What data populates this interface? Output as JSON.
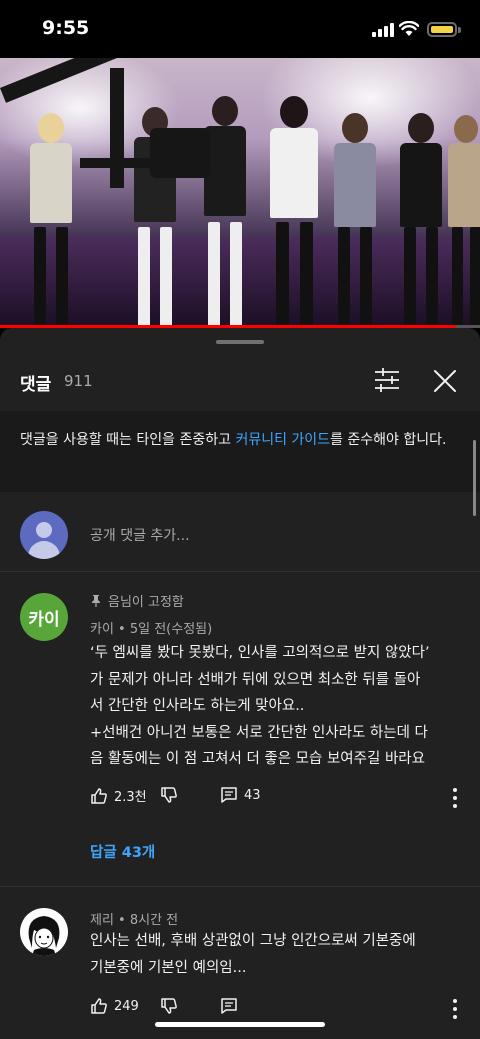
{
  "status_bar": {
    "time": "9:55"
  },
  "video": {
    "progress_fraction": 0.95
  },
  "comments_panel": {
    "title": "댓글",
    "count": "911",
    "guideline": {
      "prefix": "댓글을 사용할 때는 타인을 존중하고 ",
      "link": "커뮤니티 가이드",
      "suffix": "를 준수해야 합니다."
    },
    "add_comment_placeholder": "공개 댓글 추가...",
    "comments": [
      {
        "avatar_text": "카이",
        "pinned_label": "음님이 고정함",
        "author": "카이",
        "time": "5일 전(수정됨)",
        "lines": [
          "‘두 엠씨를 봤다 못봤다, 인사를 고의적으로 받지 않았다’",
          "가 문제가 아니라 선배가 뒤에 있으면 최소한 뒤를 돌아",
          "서 간단한 인사라도 하는게 맞아요..",
          "+선배건 아니건 보통은 서로 간단한 인사라도 하는데 다",
          "음 활동에는 이 점 고쳐서 더 좋은 모습 보여주길 바라요"
        ],
        "likes": "2.3천",
        "reply_count": "43",
        "replies_label": "답글 43개"
      },
      {
        "author": "제리",
        "time": "8시간 전",
        "lines": [
          "인사는 선배, 후배 상관없이 그냥 인간으로써 기본중에",
          "기본중에 기본인 예의임..."
        ],
        "likes": "249"
      }
    ]
  },
  "colors": {
    "accent_link": "#3ea6ff",
    "panel_bg": "#212121",
    "progress": "#ff0000",
    "avatar_green": "#58a63a"
  }
}
